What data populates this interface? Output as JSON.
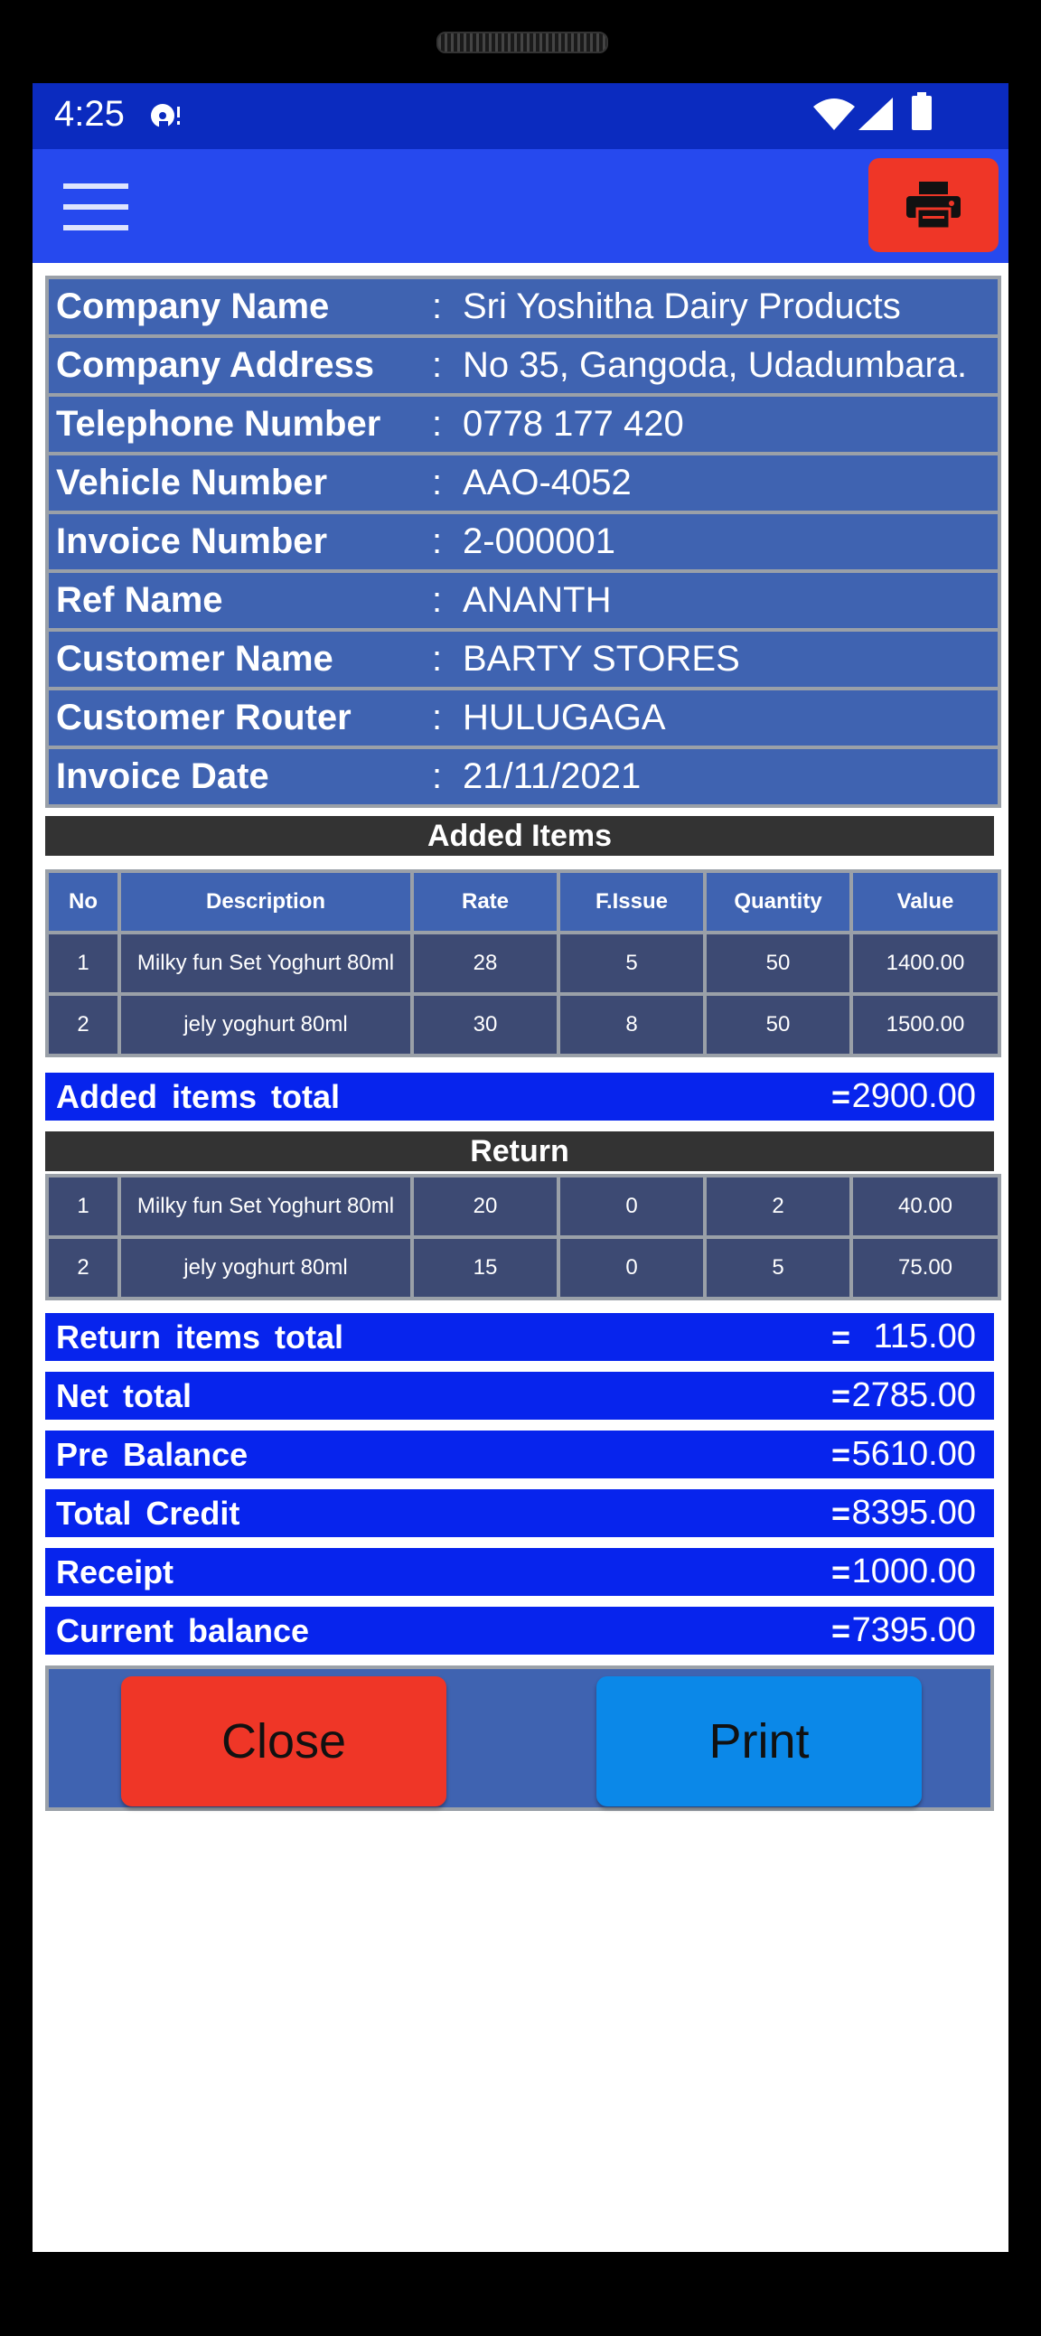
{
  "status_bar": {
    "time": "4:25",
    "icons": [
      "media-icon",
      "wifi-icon",
      "signal-icon",
      "battery-icon"
    ]
  },
  "app_bar": {
    "menu_icon": "hamburger-icon",
    "print_icon": "printer-icon",
    "accent": "#ef3627"
  },
  "invoice": [
    {
      "label": "Company Name",
      "value": "Sri Yoshitha Dairy Products"
    },
    {
      "label": "Company Address",
      "value": "No 35, Gangoda, Udadumbara."
    },
    {
      "label": "Telephone Number",
      "value": "0778 177 420"
    },
    {
      "label": "Vehicle Number",
      "value": "AAO-4052"
    },
    {
      "label": "Invoice Number",
      "value": "2-000001"
    },
    {
      "label": "Ref Name",
      "value": "ANANTH"
    },
    {
      "label": "Customer Name",
      "value": "BARTY STORES"
    },
    {
      "label": "Customer Router",
      "value": "HULUGAGA"
    },
    {
      "label": "Invoice Date",
      "value": "21/11/2021"
    }
  ],
  "added_items": {
    "title": "Added  Items",
    "columns": [
      "No",
      "Description",
      "Rate",
      "F.Issue",
      "Quantity",
      "Value"
    ],
    "rows": [
      [
        "1",
        "Milky  fun  Set  Yoghurt  80ml",
        "28",
        "5",
        "50",
        "1400.00"
      ],
      [
        "2",
        "jely  yoghurt  80ml",
        "30",
        "8",
        "50",
        "1500.00"
      ]
    ],
    "total_label": "Added  items  total",
    "total_value": "2900.00"
  },
  "returns": {
    "title": "Return",
    "rows": [
      [
        "1",
        "Milky  fun  Set  Yoghurt  80ml",
        "20",
        "0",
        "2",
        "40.00"
      ],
      [
        "2",
        "jely  yoghurt  80ml",
        "15",
        "0",
        "5",
        "75.00"
      ]
    ],
    "total_label": "Return  items  total",
    "total_value": "115.00"
  },
  "summary": [
    {
      "label": "Net  total",
      "value": "2785.00"
    },
    {
      "label": "Pre  Balance",
      "value": "5610.00"
    },
    {
      "label": "Total  Credit",
      "value": "8395.00"
    },
    {
      "label": "Receipt",
      "value": "1000.00"
    },
    {
      "label": "Current  balance",
      "value": "7395.00"
    }
  ],
  "equals": "=",
  "colon": ":",
  "buttons": {
    "close": "Close",
    "print": "Print"
  }
}
